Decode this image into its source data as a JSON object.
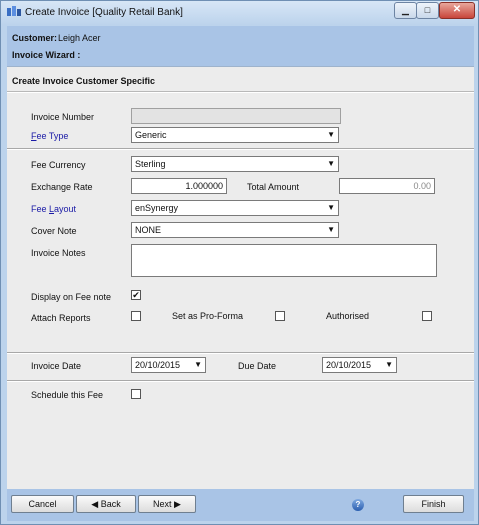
{
  "window": {
    "title": "Create Invoice [Quality Retail Bank]"
  },
  "header": {
    "customer_label": "Customer:",
    "customer_value": "Leigh Acer",
    "wizard_label": "Invoice Wizard :"
  },
  "section_title": "Create Invoice Customer Specific",
  "form": {
    "invoice_number": {
      "label": "Invoice Number",
      "value": ""
    },
    "fee_type": {
      "label_underlined": "F",
      "label_rest": "ee Type",
      "value": "Generic"
    },
    "fee_currency": {
      "label": "Fee Currency",
      "value": "Sterling"
    },
    "exchange_rate": {
      "label": "Exchange Rate",
      "value": "1.000000"
    },
    "total_amount": {
      "label": "Total Amount",
      "value": "0.00"
    },
    "fee_layout": {
      "label_pre": "Fee ",
      "label_underlined": "L",
      "label_rest": "ayout",
      "value": "enSynergy"
    },
    "cover_note": {
      "label": "Cover Note",
      "value": "NONE"
    },
    "invoice_notes": {
      "label": "Invoice Notes",
      "value": ""
    },
    "display_on_fee_note": {
      "label": "Display on Fee note",
      "checked": true,
      "mark": "✔"
    },
    "attach_reports": {
      "label": "Attach Reports",
      "checked": false
    },
    "set_as_pro_forma": {
      "label": "Set as Pro-Forma",
      "checked": false
    },
    "authorised": {
      "label": "Authorised",
      "checked": false
    },
    "invoice_date": {
      "label": "Invoice Date",
      "value": "20/10/2015"
    },
    "due_date": {
      "label": "Due Date",
      "value": "20/10/2015"
    },
    "schedule_fee": {
      "label": "Schedule this Fee",
      "checked": false
    }
  },
  "footer": {
    "cancel_label": "Cancel",
    "back_label": "Back",
    "next_label": "Next",
    "finish_label": "Finish",
    "help_glyph": "?"
  },
  "colors": {
    "link_label": "#1a1aa6",
    "header_band": "#a9c4e6",
    "content_bg": "#ececec"
  }
}
